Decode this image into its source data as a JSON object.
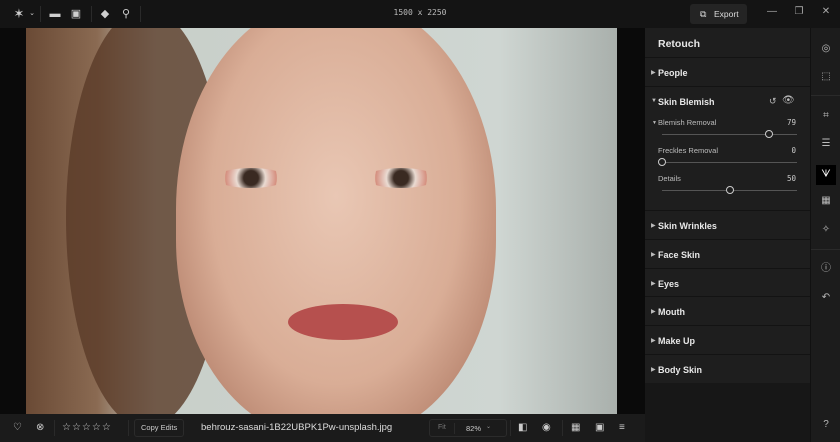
{
  "topbar": {
    "dimensions": "1500 x 2250",
    "export_label": "Export",
    "icons": [
      "logo-star-icon",
      "chevron-down-icon",
      "folder-icon",
      "image-import-icon",
      "eraser-icon",
      "zoom-icon",
      "minimize-icon",
      "restore-icon",
      "close-icon"
    ]
  },
  "panel": {
    "title": "Retouch",
    "sections": [
      {
        "label": "People",
        "expanded": false
      },
      {
        "label": "Skin Blemish",
        "expanded": true
      },
      {
        "label": "Skin Wrinkles",
        "expanded": false
      },
      {
        "label": "Face Skin",
        "expanded": false
      },
      {
        "label": "Eyes",
        "expanded": false
      },
      {
        "label": "Mouth",
        "expanded": false
      },
      {
        "label": "Make Up",
        "expanded": false
      },
      {
        "label": "Body Skin",
        "expanded": false
      }
    ],
    "sliders": [
      {
        "label": "Blemish Removal",
        "value": "79"
      },
      {
        "label": "Freckles Removal",
        "value": "0"
      },
      {
        "label": "Details",
        "value": "50"
      }
    ]
  },
  "bottombar": {
    "rating": 0,
    "copy_edits": "Copy Edits",
    "filename": "behrouz-sasani-1B22UBPK1Pw-unsplash.jpg",
    "fit": "Fit",
    "zoom": "82%"
  }
}
